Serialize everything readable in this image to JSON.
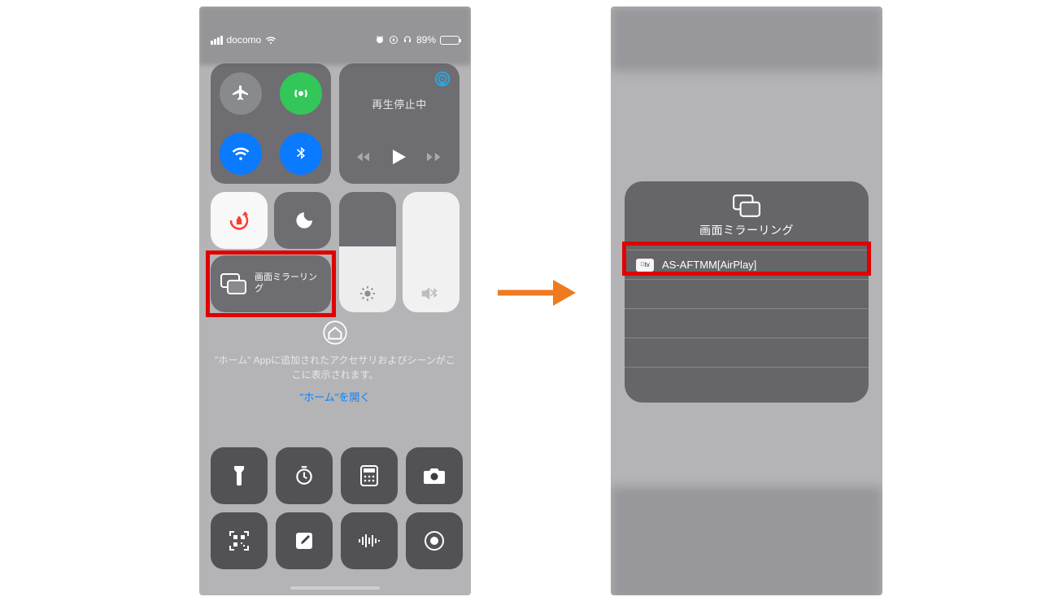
{
  "status": {
    "carrier": "docomo",
    "battery_text": "89%",
    "battery_fill_pct": 89
  },
  "media": {
    "status": "再生停止中"
  },
  "mirror": {
    "label": "画面ミラーリング"
  },
  "home": {
    "desc": "\"ホーム\" Appに追加されたアクセサリおよびシーンがここに表示されます。",
    "link": "\"ホーム\"を開く"
  },
  "popup": {
    "title": "画面ミラーリング",
    "device_badge": "tv",
    "device_name": "AS-AFTMM[AirPlay]"
  },
  "colors": {
    "highlight": "#e10000",
    "arrow": "#f07b1f",
    "green": "#33c759",
    "blue": "#0a7aff",
    "link": "#0a84ff"
  }
}
